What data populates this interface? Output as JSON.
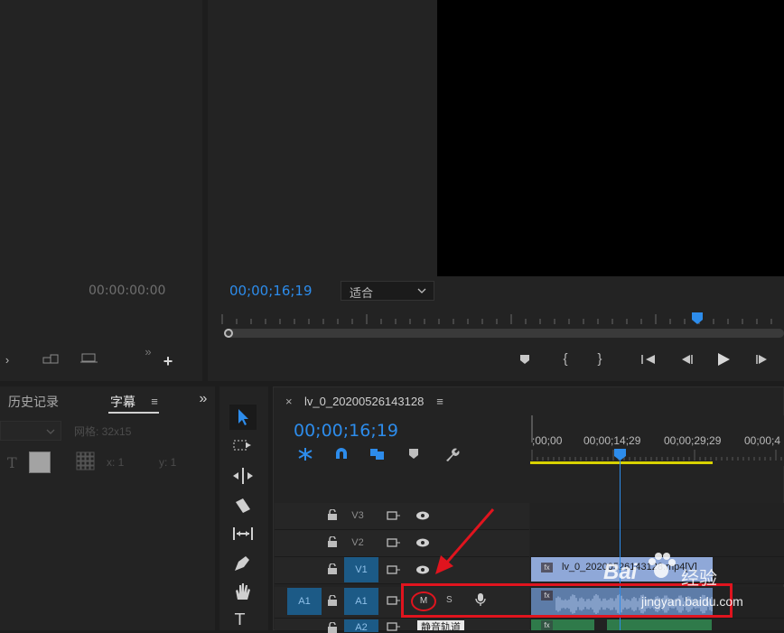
{
  "source_monitor": {
    "timecode": "00:00:00:00"
  },
  "program_monitor": {
    "timecode": "00;00;16;19",
    "fit_value": "适合"
  },
  "left_panel": {
    "tabs": [
      {
        "label": "历史记录"
      },
      {
        "label": "字幕"
      }
    ],
    "grid_label": "网格: 32x15",
    "x_label": "x: 1",
    "y_label": "y: 1"
  },
  "sequence": {
    "close": "×",
    "name": "lv_0_20200526143128",
    "timecode": "00;00;16;19",
    "ruler_labels": [
      ";00;00",
      "00;00;14;29",
      "00;00;29;29",
      "00;00;4"
    ]
  },
  "tracks": {
    "v3": "V3",
    "v2": "V2",
    "v1": "V1",
    "a1_source": "A1",
    "a1": "A1",
    "a2": "A2",
    "mute": "M",
    "solo": "S",
    "tooltip": "静音轨道"
  },
  "clips": {
    "video_label": "lv_0_20200526143128.mp4[V]",
    "fx": "fx"
  },
  "watermark": {
    "brand": "Bai",
    "brand_cn": "经验",
    "url": "jingyan.baidu.com"
  },
  "colors": {
    "accent_blue": "#2d8ceb",
    "highlight_red": "#e0141e",
    "audio_clip": "#5d7ca8",
    "video_clip": "#8fa8d8",
    "work_area": "#d8d200"
  }
}
